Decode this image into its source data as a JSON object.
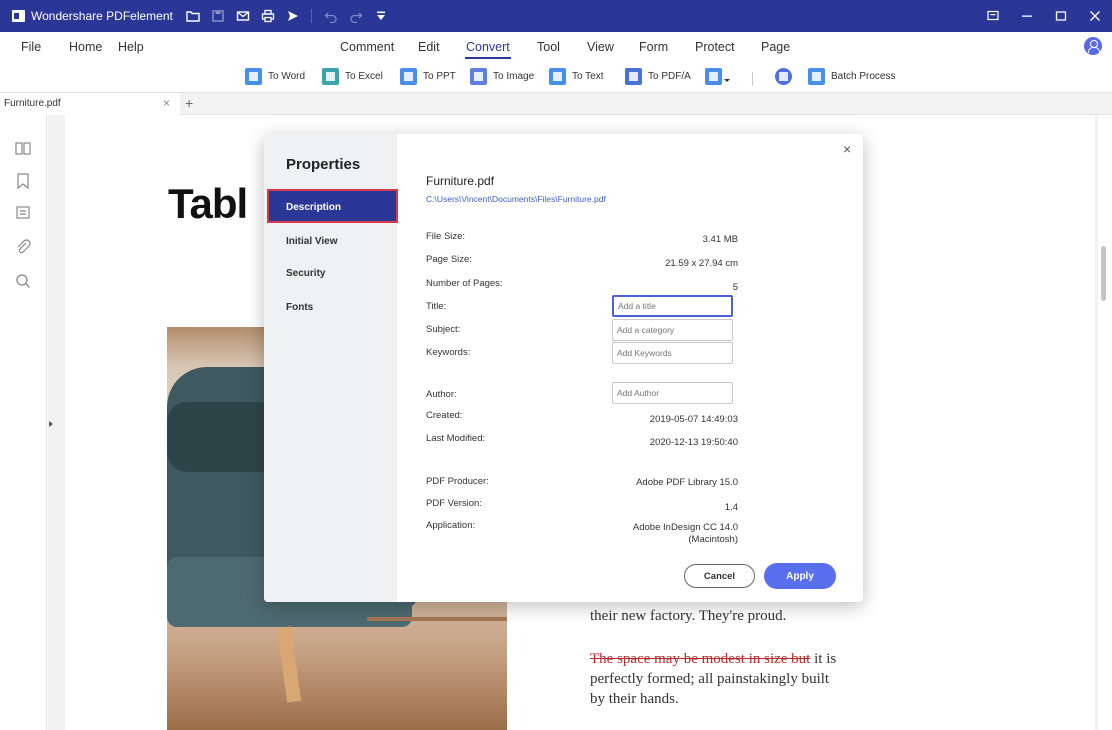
{
  "app": {
    "name": "Wondershare PDFelement"
  },
  "menu": {
    "items": [
      "File",
      "Home",
      "Help",
      "Comment",
      "Edit",
      "Convert",
      "Tool",
      "View",
      "Form",
      "Protect",
      "Page"
    ],
    "active": "Convert"
  },
  "toolbar": {
    "items": [
      "To Word",
      "To Excel",
      "To PPT",
      "To Image",
      "To Text",
      "To PDF/A",
      "",
      "",
      "Batch Process"
    ]
  },
  "tabs": {
    "current": "Furniture.pdf",
    "close": "×",
    "new": "+"
  },
  "document": {
    "title_fragment": "Tabl",
    "line1": "their new factory. They're proud.",
    "strike": "The space may be modest in size but",
    "line2_rest": " it is",
    "line3": "perfectly formed; all painstakingly built",
    "line4": "by their hands."
  },
  "dialog": {
    "title": "Properties",
    "close": "×",
    "nav": [
      "Description",
      "Initial View",
      "Security",
      "Fonts"
    ],
    "file_name": "Furniture.pdf",
    "file_path": "C:\\Users\\Vincent\\Documents\\Files\\Furniture.pdf",
    "file_size_label": "File Size:",
    "file_size": "3.41 MB",
    "page_size_label": "Page Size:",
    "page_size": "21.59 x 27.94 cm",
    "pages_label": "Number of Pages:",
    "pages": "5",
    "title_label": "Title:",
    "title_placeholder": "Add a title",
    "subject_label": "Subject:",
    "subject_placeholder": "Add a category",
    "keywords_label": "Keywords:",
    "keywords_placeholder": "Add Keywords",
    "author_label": "Author:",
    "author_placeholder": "Add Author",
    "created_label": "Created:",
    "created": "2019-05-07 14:49:03",
    "modified_label": "Last Modified:",
    "modified": "2020-12-13 19:50:40",
    "producer_label": "PDF Producer:",
    "producer": "Adobe PDF Library 15.0",
    "version_label": "PDF Version:",
    "version": "1.4",
    "application_label": "Application:",
    "application_line1": "Adobe InDesign CC 14.0",
    "application_line2": "(Macintosh)",
    "cancel": "Cancel",
    "apply": "Apply"
  },
  "colors": {
    "brand": "#2b3797",
    "accent": "#5a6ff0",
    "link": "#3e63c4",
    "highlight_border": "#d43b4a"
  }
}
